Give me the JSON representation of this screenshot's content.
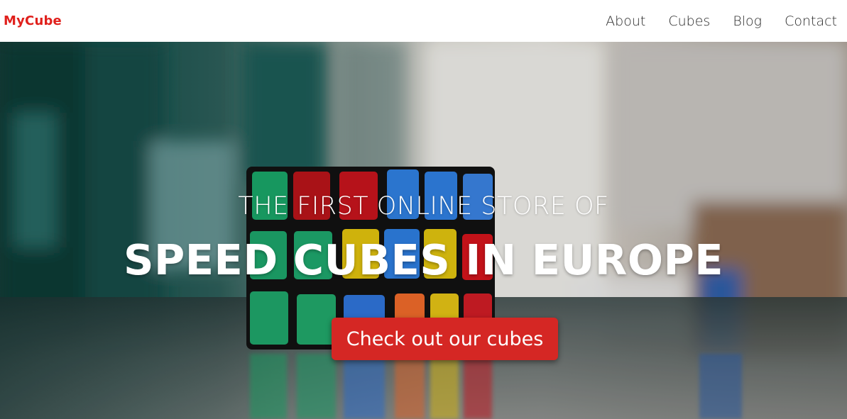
{
  "brand": {
    "name": "MyCube",
    "color": "#e0201c"
  },
  "nav": {
    "items": [
      {
        "label": "About"
      },
      {
        "label": "Cubes"
      },
      {
        "label": "Blog"
      },
      {
        "label": "Contact"
      }
    ]
  },
  "hero": {
    "subtitle": "THE FIRST ONLINE STORE OF",
    "headline": "SPEED CUBES IN EUROPE",
    "cta_label": "Check out our cubes",
    "cta_color": "#d52724",
    "background_image": "rubiks-cube-on-table-photo"
  }
}
